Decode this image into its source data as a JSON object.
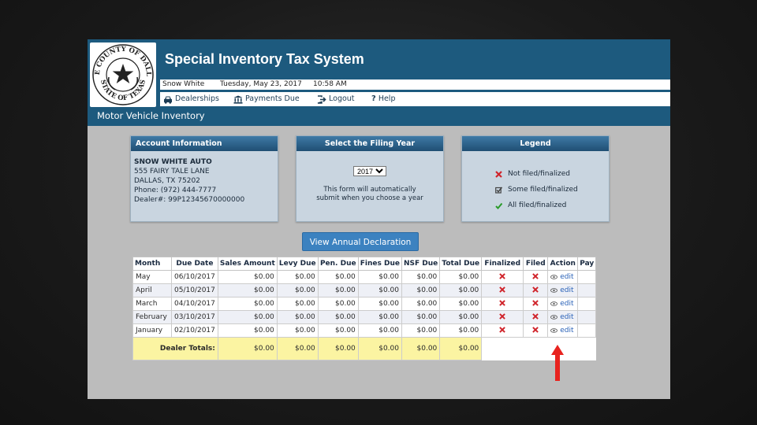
{
  "header": {
    "logo": {
      "top_text": "THE COUNTY OF DALLAS",
      "bottom_text": "STATE OF TEXAS"
    },
    "title": "Special Inventory Tax System",
    "user": "Snow White",
    "date": "Tuesday, May 23, 2017",
    "time": "10:58 AM",
    "nav": {
      "dealerships": "Dealerships",
      "payments_due": "Payments Due",
      "logout": "Logout",
      "help": "Help"
    }
  },
  "section_title": "Motor Vehicle Inventory",
  "account_panel": {
    "heading": "Account Information",
    "name": "SNOW WHITE AUTO",
    "address1": "555 FAIRY TALE LANE",
    "address2": "DALLAS, TX 75202",
    "phone": "Phone: (972) 444-7777",
    "dealer": "Dealer#: 99P12345670000000"
  },
  "filing_panel": {
    "heading": "Select the Filing Year",
    "selected_year": "2017",
    "note_line1": "This form will automatically",
    "note_line2": "submit when you choose a year"
  },
  "legend_panel": {
    "heading": "Legend",
    "items": [
      {
        "label": "Not filed/finalized",
        "icon": "red-x-icon",
        "color": "#d0232a"
      },
      {
        "label": "Some filed/finalized",
        "icon": "checkbox-icon",
        "color": "#444444"
      },
      {
        "label": "All filed/finalized",
        "icon": "green-check-icon",
        "color": "#2a9b2a"
      }
    ]
  },
  "annual_button": "View Annual Declaration",
  "table": {
    "headers": [
      "Month",
      "Due Date",
      "Sales Amount",
      "Levy Due",
      "Pen. Due",
      "Fines Due",
      "NSF Due",
      "Total Due",
      "Finalized",
      "Filed",
      "Action",
      "Pay"
    ],
    "rows": [
      {
        "month": "May",
        "due_date": "06/10/2017",
        "sales": "$0.00",
        "levy": "$0.00",
        "pen": "$0.00",
        "fines": "$0.00",
        "nsf": "$0.00",
        "total": "$0.00",
        "action": "edit"
      },
      {
        "month": "April",
        "due_date": "05/10/2017",
        "sales": "$0.00",
        "levy": "$0.00",
        "pen": "$0.00",
        "fines": "$0.00",
        "nsf": "$0.00",
        "total": "$0.00",
        "action": "edit"
      },
      {
        "month": "March",
        "due_date": "04/10/2017",
        "sales": "$0.00",
        "levy": "$0.00",
        "pen": "$0.00",
        "fines": "$0.00",
        "nsf": "$0.00",
        "total": "$0.00",
        "action": "edit"
      },
      {
        "month": "February",
        "due_date": "03/10/2017",
        "sales": "$0.00",
        "levy": "$0.00",
        "pen": "$0.00",
        "fines": "$0.00",
        "nsf": "$0.00",
        "total": "$0.00",
        "action": "edit"
      },
      {
        "month": "January",
        "due_date": "02/10/2017",
        "sales": "$0.00",
        "levy": "$0.00",
        "pen": "$0.00",
        "fines": "$0.00",
        "nsf": "$0.00",
        "total": "$0.00",
        "action": "edit"
      }
    ],
    "totals": {
      "label": "Dealer Totals:",
      "sales": "$0.00",
      "levy": "$0.00",
      "pen": "$0.00",
      "fines": "$0.00",
      "nsf": "$0.00",
      "total": "$0.00"
    }
  },
  "colors": {
    "header_bg": "#1d5a7e",
    "panel_head": "#2a5f88",
    "button_blue": "#3c82c0",
    "totals_bg": "#fbf4a2",
    "status_red": "#d0232a",
    "arrow_red": "#e8231f"
  }
}
